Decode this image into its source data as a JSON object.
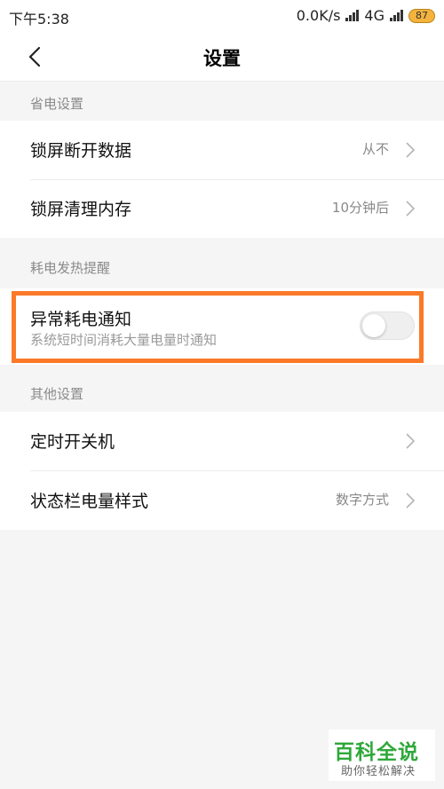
{
  "status_bar": {
    "time": "下午5:38",
    "network_speed": "0.0K/s",
    "network_type": "4G",
    "battery": "87"
  },
  "nav": {
    "title": "设置",
    "back_icon": "chevron-left-icon"
  },
  "sections": [
    {
      "header": "省电设置",
      "rows": [
        {
          "label": "锁屏断开数据",
          "value": "从不"
        },
        {
          "label": "锁屏清理内存",
          "value": "10分钟后"
        }
      ]
    },
    {
      "header": "耗电发热提醒",
      "toggle": {
        "title": "异常耗电通知",
        "subtitle": "系统短时间消耗大量电量时通知",
        "enabled": false
      }
    },
    {
      "header": "其他设置",
      "rows": [
        {
          "label": "定时开关机",
          "value": ""
        },
        {
          "label": "状态栏电量样式",
          "value": "数字方式"
        }
      ]
    }
  ],
  "highlight_color": "#fb7a28",
  "watermark": {
    "title": "百科全说",
    "subtitle": "助你轻松解决"
  }
}
